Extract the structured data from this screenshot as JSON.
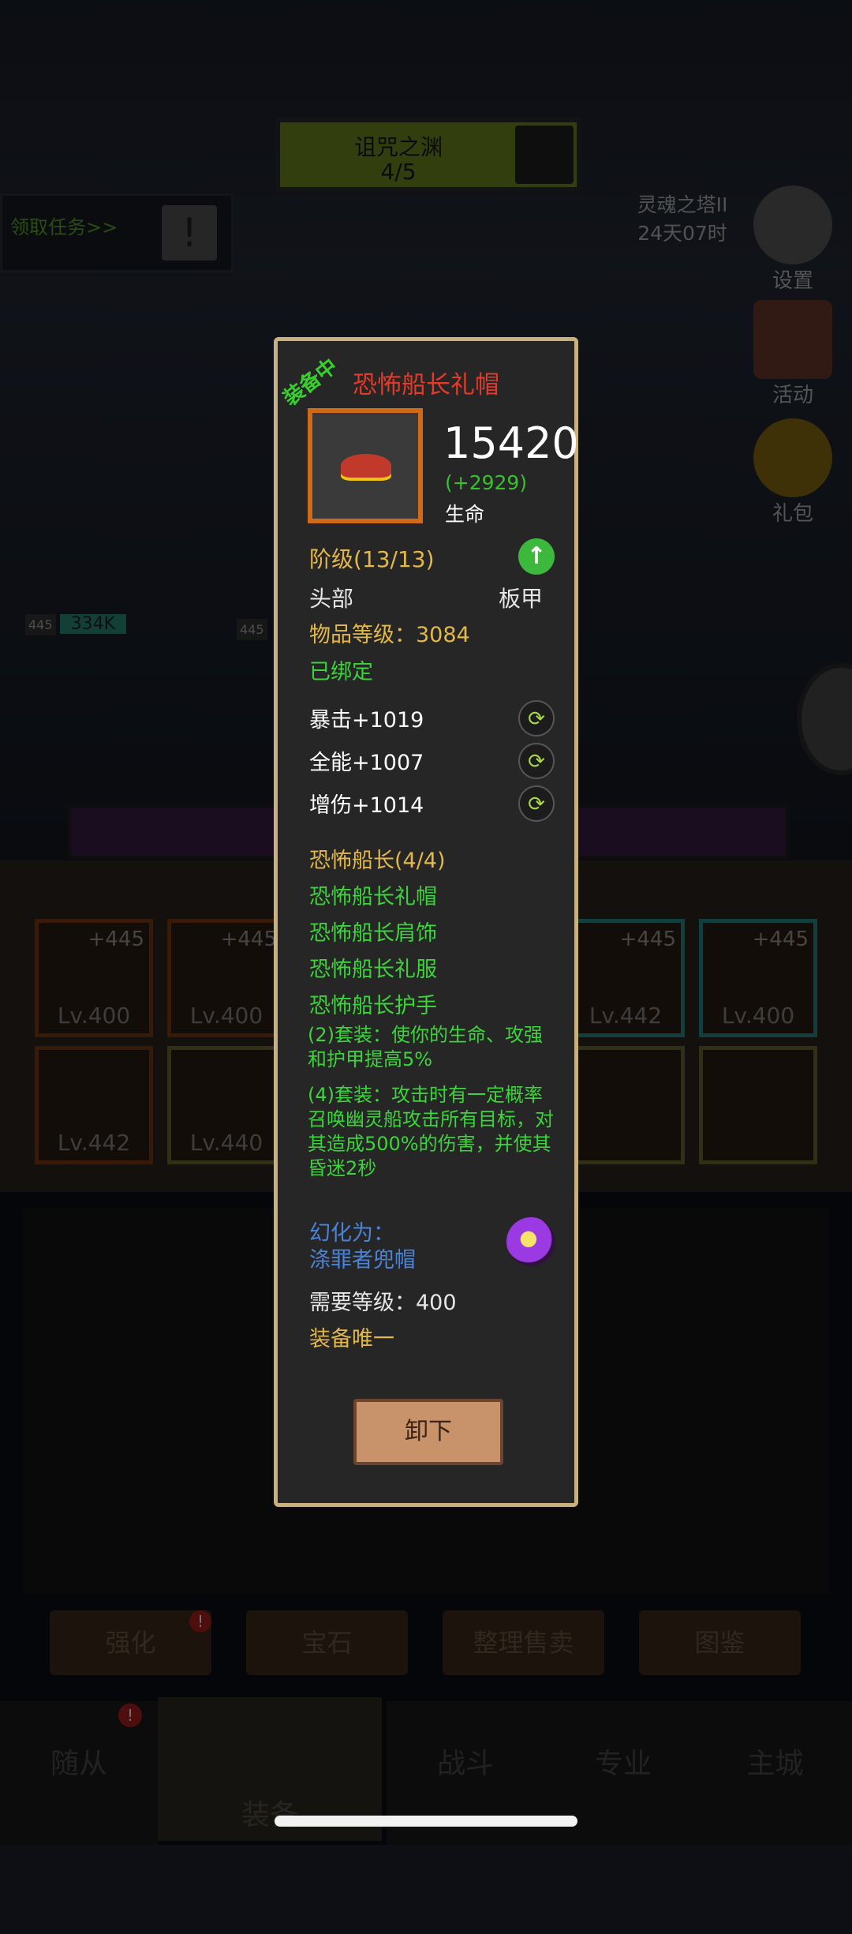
{
  "stage": {
    "name": "诅咒之渊",
    "progress": "4/5"
  },
  "task": {
    "label": "领取任务>>",
    "icon": "!"
  },
  "tower": {
    "name": "灵魂之塔II",
    "timer": "24天07时"
  },
  "side_buttons": {
    "settings": "设置",
    "activity": "活动",
    "gift": "礼包"
  },
  "hero_bar": {
    "level": "445",
    "hp": "334K",
    "level2": "445"
  },
  "equipment_slots": [
    {
      "plus": "+445",
      "lv": "Lv.400",
      "icon": "hat-icon"
    },
    {
      "plus": "+445",
      "lv": "Lv.400",
      "icon": "shoulder-icon"
    },
    {
      "plus": "+445",
      "lv": "Lv.442",
      "icon": "sword-icon"
    },
    {
      "plus": "+445",
      "lv": "Lv.400",
      "icon": "axe-icon"
    },
    {
      "plus": "",
      "lv": "Lv.442",
      "icon": "star-icon"
    },
    {
      "plus": "",
      "lv": "Lv.440",
      "icon": "ring-icon"
    },
    {
      "plus": "",
      "lv": "",
      "icon": "chest-icon"
    },
    {
      "plus": "",
      "lv": "",
      "icon": "gem-icon"
    }
  ],
  "bottom_buttons": [
    "强化",
    "宝石",
    "整理售卖",
    "图鉴"
  ],
  "nav": [
    "随从",
    "装备",
    "战斗",
    "专业",
    "主城"
  ],
  "item": {
    "equipped_tag": "装备中",
    "name": "恐怖船长礼帽",
    "stat_value": "15420",
    "stat_increase": "(+2929)",
    "stat_label": "生命",
    "tier": "阶级(13/13)",
    "slot": "头部",
    "armor": "板甲",
    "item_level": "物品等级：3084",
    "bound": "已绑定",
    "affixes": [
      "暴击+1019",
      "全能+1007",
      "增伤+1014"
    ],
    "set_name": "恐怖船长(4/4)",
    "set_pieces": [
      "恐怖船长礼帽",
      "恐怖船长肩饰",
      "恐怖船长礼服",
      "恐怖船长护手"
    ],
    "set_bonus_2": "(2)套装：使你的生命、攻强和护甲提高5%",
    "set_bonus_4": "(4)套装：攻击时有一定概率召唤幽灵船攻击所有目标，对其造成500%的伤害，并使其昏迷2秒",
    "transmog_label": "幻化为：",
    "transmog_name": "涤罪者兜帽",
    "required_level": "需要等级：400",
    "unique": "装备唯一",
    "unequip_button": "卸下"
  },
  "colors": {
    "item_name": "#e33a2a",
    "green": "#3bd43a",
    "gold": "#e3b848",
    "border": "#c9b17f"
  }
}
